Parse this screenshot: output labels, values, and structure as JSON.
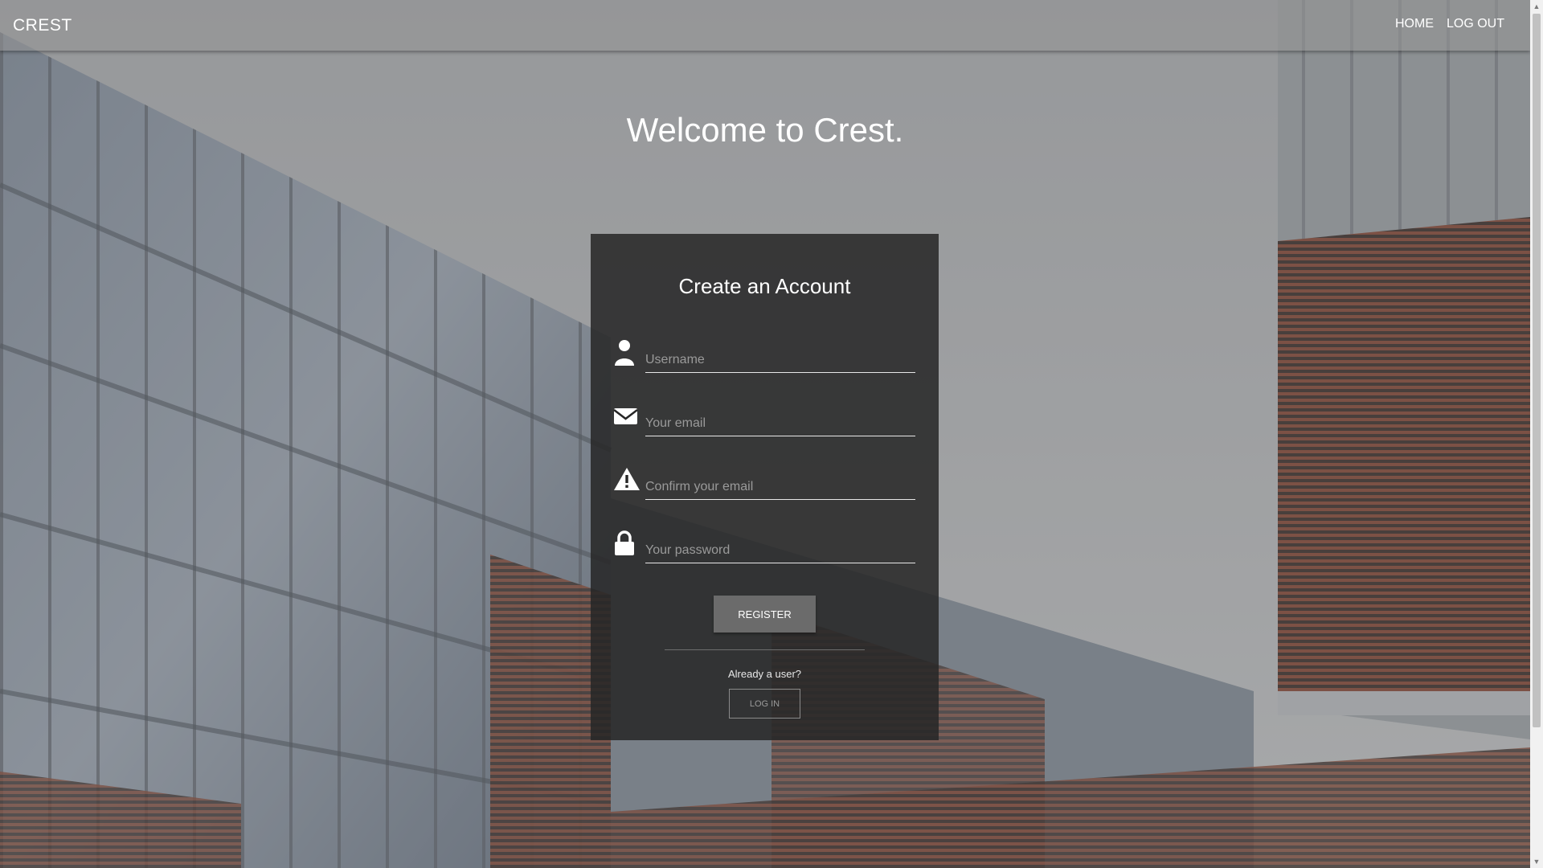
{
  "navbar": {
    "brand": "CREST",
    "links": [
      {
        "label": "HOME"
      },
      {
        "label": "LOG OUT"
      }
    ]
  },
  "hero": {
    "title": "Welcome to Crest."
  },
  "form": {
    "title": "Create an Account",
    "fields": [
      {
        "icon": "user-icon",
        "placeholder": "Username",
        "value": ""
      },
      {
        "icon": "envelope-icon",
        "placeholder": "Your email",
        "value": ""
      },
      {
        "icon": "warning-icon",
        "placeholder": "Confirm your email",
        "value": ""
      },
      {
        "icon": "lock-icon",
        "placeholder": "Your password",
        "value": ""
      }
    ],
    "register_label": "REGISTER",
    "already_text": "Already a user?",
    "login_label": "LOG IN"
  },
  "colors": {
    "card_background": "#262626",
    "register_button": "#6b6b6b",
    "accent_text": "#ffffff"
  }
}
